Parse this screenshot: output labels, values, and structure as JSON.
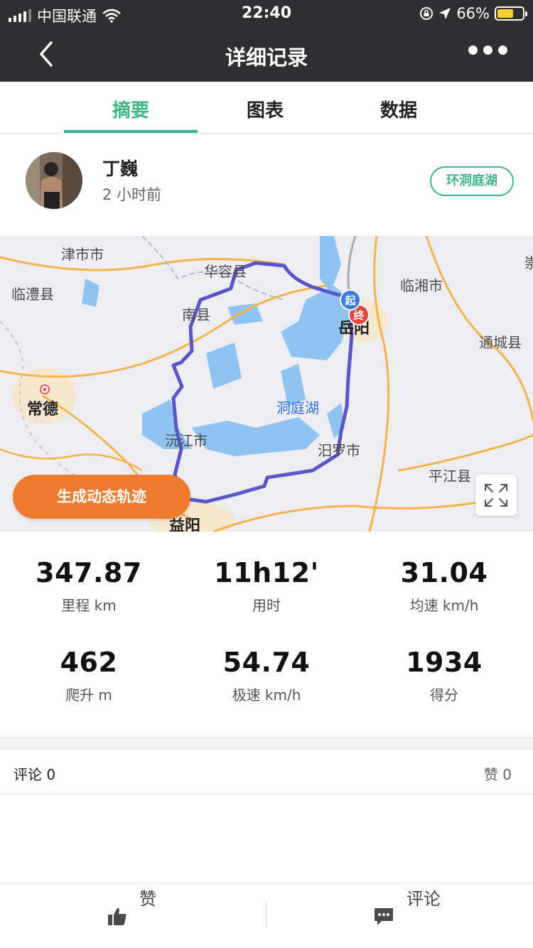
{
  "status_bar": {
    "carrier": "中国联通",
    "time": "22:40",
    "battery": "66%",
    "battery_level": 0.66
  },
  "nav": {
    "title": "详细记录",
    "back_icon": "chevron-left-icon",
    "more_icon": "more-dots-icon"
  },
  "tabs": [
    {
      "label": "摘要",
      "active": true
    },
    {
      "label": "图表",
      "active": false
    },
    {
      "label": "数据",
      "active": false
    }
  ],
  "user": {
    "name": "丁巍",
    "time_ago": "2 小时前",
    "route_badge": "环洞庭湖"
  },
  "map": {
    "labels": {
      "jinshi": "津市市",
      "lixian": "临澧县",
      "huarong": "华容县",
      "nanxian": "南县",
      "changde": "常德",
      "yuanjiang": "沅江市",
      "dongtinghu": "洞庭湖",
      "linxiang": "临湘市",
      "yueyang": "岳阳",
      "tongcheng": "通城县",
      "miluo": "汨罗市",
      "pingjiang": "平江县",
      "yiyang": "益阳",
      "edge": "崇"
    },
    "start_marker": "起",
    "end_marker": "终",
    "generate_button": "生成动态轨迹",
    "expand_icon": "expand-icon",
    "route_color": "#5a55c8"
  },
  "stats": [
    {
      "value": "347.87",
      "label": "里程 km"
    },
    {
      "value": "11h12'",
      "label": "用时"
    },
    {
      "value": "31.04",
      "label": "均速 km/h"
    },
    {
      "value": "462",
      "label": "爬升 m"
    },
    {
      "value": "54.74",
      "label": "极速 km/h"
    },
    {
      "value": "1934",
      "label": "得分"
    }
  ],
  "social": {
    "comments": "评论 0",
    "likes": "赞 0"
  },
  "bottom_bar": {
    "like_label": "赞",
    "comment_label": "评论",
    "like_icon": "thumbs-up-icon",
    "comment_icon": "comment-icon"
  },
  "colors": {
    "accent": "#3fb58a",
    "nav_bg": "#2f2f31",
    "button_orange": "#ee7b30"
  }
}
